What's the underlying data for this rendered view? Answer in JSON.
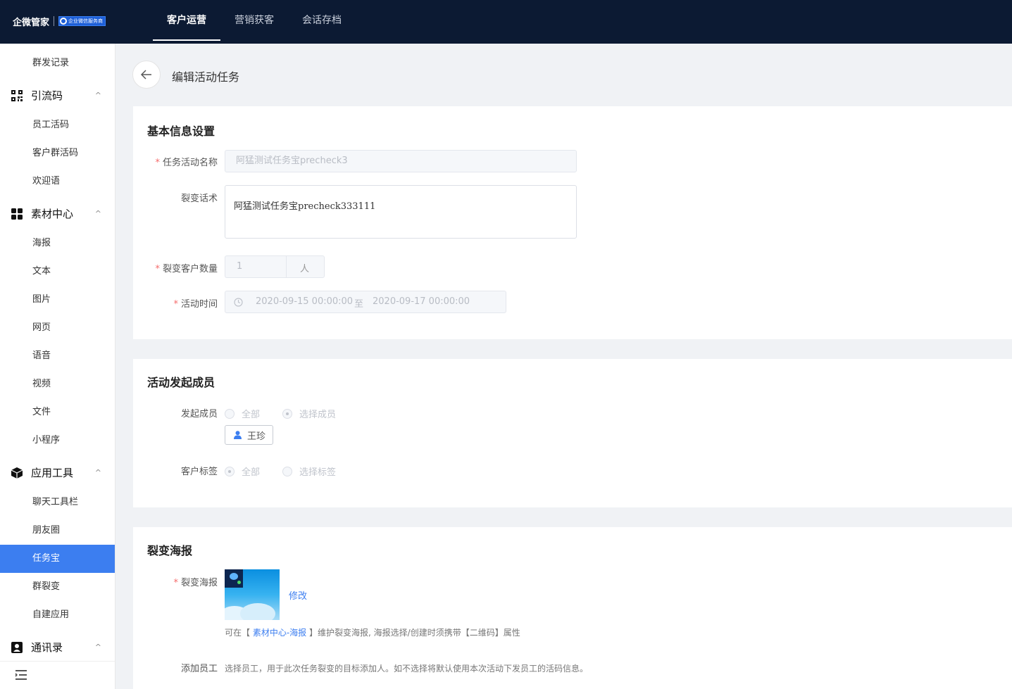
{
  "brand": {
    "name": "企微管家",
    "badge": "企业微信服务商"
  },
  "nav": {
    "tabs": [
      "客户运营",
      "营销获客",
      "会话存档"
    ],
    "active_index": 0
  },
  "sidebar": {
    "items": [
      {
        "type": "sub",
        "label": "群发记录"
      },
      {
        "type": "group",
        "label": "引流码",
        "icon": "qrcode-icon"
      },
      {
        "type": "sub",
        "label": "员工活码"
      },
      {
        "type": "sub",
        "label": "客户群活码"
      },
      {
        "type": "sub",
        "label": "欢迎语"
      },
      {
        "type": "group",
        "label": "素材中心",
        "icon": "grid-icon"
      },
      {
        "type": "sub",
        "label": "海报"
      },
      {
        "type": "sub",
        "label": "文本"
      },
      {
        "type": "sub",
        "label": "图片"
      },
      {
        "type": "sub",
        "label": "网页"
      },
      {
        "type": "sub",
        "label": "语音"
      },
      {
        "type": "sub",
        "label": "视频"
      },
      {
        "type": "sub",
        "label": "文件"
      },
      {
        "type": "sub",
        "label": "小程序"
      },
      {
        "type": "group",
        "label": "应用工具",
        "icon": "cube-icon"
      },
      {
        "type": "sub",
        "label": "聊天工具栏"
      },
      {
        "type": "sub",
        "label": "朋友圈"
      },
      {
        "type": "sub",
        "label": "任务宝",
        "active": true
      },
      {
        "type": "sub",
        "label": "群裂变"
      },
      {
        "type": "sub",
        "label": "自建应用"
      },
      {
        "type": "group",
        "label": "通讯录",
        "icon": "contacts-icon"
      }
    ],
    "chevron": "^"
  },
  "page": {
    "title": "编辑活动任务"
  },
  "basic": {
    "title": "基本信息设置",
    "name_label": "任务活动名称",
    "name_value": "阿猛测试任务宝precheck3",
    "script_label": "裂变话术",
    "script_value": "阿猛测试任务宝precheck333111",
    "count_label": "裂变客户数量",
    "count_value": "1",
    "count_unit": "人",
    "time_label": "活动时间",
    "time_start": "2020-09-15 00:00:00",
    "time_sep": "至",
    "time_end": "2020-09-17 00:00:00"
  },
  "members": {
    "title": "活动发起成员",
    "member_label": "发起成员",
    "opt_all": "全部",
    "opt_select_member": "选择成员",
    "selected_member": "王珍",
    "tag_label": "客户标签",
    "opt_tag_all": "全部",
    "opt_select_tag": "选择标签"
  },
  "poster": {
    "title": "裂变海报",
    "poster_label": "裂变海报",
    "edit_link": "修改",
    "hint_pre": "可在【",
    "hint_link": "素材中心-海报",
    "hint_post": "】维护裂变海报, 海报选择/创建时须携带【二维码】属性",
    "staff_label": "添加员工",
    "staff_hint": "选择员工，用于此次任务裂变的目标添加人。如不选择将默认使用本次活动下发员工的活码信息。"
  },
  "colors": {
    "topbar": "#0c1a33",
    "accent": "#3c7ef0",
    "required": "#f56c6c"
  }
}
